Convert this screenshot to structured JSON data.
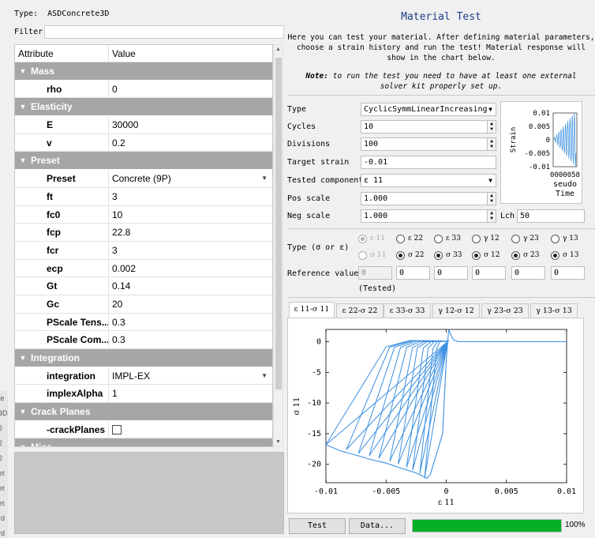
{
  "left": {
    "type_label": "Type:",
    "type_value": "ASDConcrete3D",
    "filter_label": "Filter",
    "filter_value": "",
    "columns": [
      "Attribute",
      "Value"
    ],
    "groups": [
      {
        "name": "Mass",
        "rows": [
          {
            "key": "rho",
            "value": "0"
          }
        ]
      },
      {
        "name": "Elasticity",
        "rows": [
          {
            "key": "E",
            "value": "30000"
          },
          {
            "key": "v",
            "value": "0.2"
          }
        ]
      },
      {
        "name": "Preset",
        "rows": [
          {
            "key": "Preset",
            "value": "Concrete (9P)",
            "dropdown": true
          },
          {
            "key": "ft",
            "value": "3"
          },
          {
            "key": "fc0",
            "value": "10"
          },
          {
            "key": "fcp",
            "value": "22.8"
          },
          {
            "key": "fcr",
            "value": "3"
          },
          {
            "key": "ecp",
            "value": "0.002"
          },
          {
            "key": "Gt",
            "value": "0.14"
          },
          {
            "key": "Gc",
            "value": "20"
          },
          {
            "key": "PScale Tens...",
            "value": "0.3"
          },
          {
            "key": "PScale Com...",
            "value": "0.3"
          }
        ]
      },
      {
        "name": "Integration",
        "rows": [
          {
            "key": "integration",
            "value": "IMPL-EX",
            "dropdown": true
          },
          {
            "key": "implexAlpha",
            "value": "1"
          }
        ]
      },
      {
        "name": "Crack Planes",
        "rows": [
          {
            "key": "-crackPlanes",
            "value": "",
            "checkbox": true
          }
        ]
      },
      {
        "name": "Misc",
        "rows": []
      }
    ],
    "side_strip": [
      "te",
      "3D",
      "2",
      "2",
      "2",
      "et",
      "et",
      "et",
      "rd",
      "rd"
    ]
  },
  "right": {
    "title": "Material Test",
    "description": "Here you can test your material. After defining material parameters, choose a strain history and run the test! Material response will show in the chart below.",
    "note_label": "Note:",
    "note_text": "to run the test you need to have at least one external solver kit properly set up.",
    "form": {
      "type_label": "Type",
      "type_value": "CyclicSymmLinearIncreasing",
      "cycles_label": "Cycles",
      "cycles_value": "10",
      "divisions_label": "Divisions",
      "divisions_value": "100",
      "target_label": "Target strain",
      "target_value": "-0.01",
      "component_label": "Tested component",
      "component_value": "ε 11",
      "pos_label": "Pos scale",
      "pos_value": "1.000",
      "neg_label": "Neg scale",
      "neg_value": "1.000",
      "lch_label": "Lch",
      "lch_value": "50"
    },
    "mini_plot": {
      "y_ticks": [
        "0.01",
        "0.005",
        "0",
        "-0.005",
        "-0.01"
      ],
      "ylabel": "Strain",
      "xlabel_top": "0000058",
      "xlabel_mid": "seudo",
      "xlabel_bot": "Time"
    },
    "type_sel_label": "Type (σ or ε)",
    "strain_labels": [
      "ε 11",
      "ε 22",
      "ε 33",
      "γ 12",
      "γ 23",
      "γ 13"
    ],
    "stress_labels": [
      "σ 11",
      "σ 22",
      "σ 33",
      "σ 12",
      "σ 23",
      "σ 13"
    ],
    "ref_label": "Reference value",
    "ref_values": [
      "0",
      "0",
      "0",
      "0",
      "0",
      "0"
    ],
    "tested_label": "(Tested)",
    "tabs": [
      "ε 11-σ 11",
      "ε 22-σ 22",
      "ε 33-σ 33",
      "γ 12-σ 12",
      "γ 23-σ 23",
      "γ 13-σ 13"
    ],
    "test_button": "Test",
    "data_button": "Data...",
    "progress_value": 1.0,
    "progress_text": "100%",
    "progress_color": "#06b025"
  },
  "chart_data": {
    "type": "line",
    "xlabel": "ε 11",
    "ylabel": "σ 11",
    "xlim": [
      -0.01,
      0.01
    ],
    "ylim": [
      -23,
      2
    ],
    "x_ticks": [
      "-0.01",
      "-0.005",
      "0",
      "0.005",
      "0.01"
    ],
    "y_ticks": [
      "0",
      "-5",
      "-10",
      "-15",
      "-20"
    ],
    "color": "#3a8fe0",
    "envelope": {
      "x": [
        -0.01,
        -0.0088,
        -0.0075,
        -0.0063,
        -0.005,
        -0.0038,
        -0.0025,
        -0.0016,
        -0.0013,
        -0.0003,
        0.0,
        0.0002,
        0.0004,
        0.0006,
        0.001,
        0.002,
        0.01
      ],
      "y": [
        -16.8,
        -17.8,
        -18.5,
        -19.2,
        -19.8,
        -20.6,
        -21.4,
        -22.3,
        -21.5,
        -15.0,
        -3.0,
        2.0,
        1.0,
        0.3,
        0.0,
        0.0,
        0.0
      ]
    },
    "cycles": {
      "peaks_x": [
        -0.0018,
        -0.0022,
        -0.0028,
        -0.0033,
        -0.004,
        -0.0047,
        -0.0056,
        -0.0064,
        -0.0073,
        -0.0083,
        -0.01
      ],
      "peaks_y": [
        -22.3,
        -21.5,
        -21.0,
        -20.5,
        -20.0,
        -19.5,
        -19.0,
        -18.6,
        -18.2,
        -17.6,
        -16.8
      ],
      "unload_x": [
        -0.0008,
        -0.0011,
        -0.0015,
        -0.0019,
        -0.0024,
        -0.0028,
        -0.0033,
        -0.0038,
        -0.0043,
        -0.0047,
        -0.005
      ],
      "reload_x": [
        -0.0004,
        -0.0006,
        -0.0008,
        -0.0009,
        -0.0011,
        -0.0012,
        -0.0013,
        -0.0014,
        -0.0015,
        -0.0016,
        -0.0017
      ]
    }
  }
}
